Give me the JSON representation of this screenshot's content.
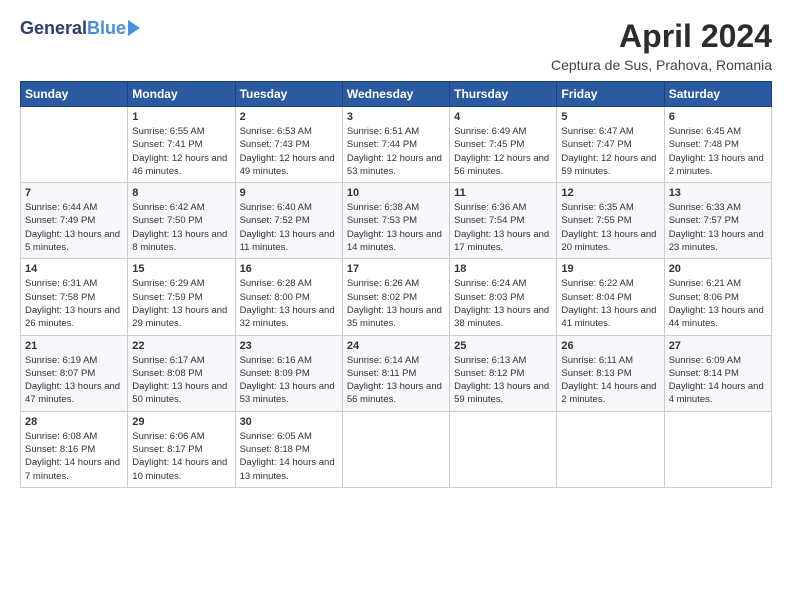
{
  "header": {
    "logo_general": "General",
    "logo_blue": "Blue",
    "title": "April 2024",
    "location": "Ceptura de Sus, Prahova, Romania"
  },
  "days_of_week": [
    "Sunday",
    "Monday",
    "Tuesday",
    "Wednesday",
    "Thursday",
    "Friday",
    "Saturday"
  ],
  "weeks": [
    [
      {
        "day": "",
        "sunrise": "",
        "sunset": "",
        "daylight": ""
      },
      {
        "day": "1",
        "sunrise": "Sunrise: 6:55 AM",
        "sunset": "Sunset: 7:41 PM",
        "daylight": "Daylight: 12 hours and 46 minutes."
      },
      {
        "day": "2",
        "sunrise": "Sunrise: 6:53 AM",
        "sunset": "Sunset: 7:43 PM",
        "daylight": "Daylight: 12 hours and 49 minutes."
      },
      {
        "day": "3",
        "sunrise": "Sunrise: 6:51 AM",
        "sunset": "Sunset: 7:44 PM",
        "daylight": "Daylight: 12 hours and 53 minutes."
      },
      {
        "day": "4",
        "sunrise": "Sunrise: 6:49 AM",
        "sunset": "Sunset: 7:45 PM",
        "daylight": "Daylight: 12 hours and 56 minutes."
      },
      {
        "day": "5",
        "sunrise": "Sunrise: 6:47 AM",
        "sunset": "Sunset: 7:47 PM",
        "daylight": "Daylight: 12 hours and 59 minutes."
      },
      {
        "day": "6",
        "sunrise": "Sunrise: 6:45 AM",
        "sunset": "Sunset: 7:48 PM",
        "daylight": "Daylight: 13 hours and 2 minutes."
      }
    ],
    [
      {
        "day": "7",
        "sunrise": "Sunrise: 6:44 AM",
        "sunset": "Sunset: 7:49 PM",
        "daylight": "Daylight: 13 hours and 5 minutes."
      },
      {
        "day": "8",
        "sunrise": "Sunrise: 6:42 AM",
        "sunset": "Sunset: 7:50 PM",
        "daylight": "Daylight: 13 hours and 8 minutes."
      },
      {
        "day": "9",
        "sunrise": "Sunrise: 6:40 AM",
        "sunset": "Sunset: 7:52 PM",
        "daylight": "Daylight: 13 hours and 11 minutes."
      },
      {
        "day": "10",
        "sunrise": "Sunrise: 6:38 AM",
        "sunset": "Sunset: 7:53 PM",
        "daylight": "Daylight: 13 hours and 14 minutes."
      },
      {
        "day": "11",
        "sunrise": "Sunrise: 6:36 AM",
        "sunset": "Sunset: 7:54 PM",
        "daylight": "Daylight: 13 hours and 17 minutes."
      },
      {
        "day": "12",
        "sunrise": "Sunrise: 6:35 AM",
        "sunset": "Sunset: 7:55 PM",
        "daylight": "Daylight: 13 hours and 20 minutes."
      },
      {
        "day": "13",
        "sunrise": "Sunrise: 6:33 AM",
        "sunset": "Sunset: 7:57 PM",
        "daylight": "Daylight: 13 hours and 23 minutes."
      }
    ],
    [
      {
        "day": "14",
        "sunrise": "Sunrise: 6:31 AM",
        "sunset": "Sunset: 7:58 PM",
        "daylight": "Daylight: 13 hours and 26 minutes."
      },
      {
        "day": "15",
        "sunrise": "Sunrise: 6:29 AM",
        "sunset": "Sunset: 7:59 PM",
        "daylight": "Daylight: 13 hours and 29 minutes."
      },
      {
        "day": "16",
        "sunrise": "Sunrise: 6:28 AM",
        "sunset": "Sunset: 8:00 PM",
        "daylight": "Daylight: 13 hours and 32 minutes."
      },
      {
        "day": "17",
        "sunrise": "Sunrise: 6:26 AM",
        "sunset": "Sunset: 8:02 PM",
        "daylight": "Daylight: 13 hours and 35 minutes."
      },
      {
        "day": "18",
        "sunrise": "Sunrise: 6:24 AM",
        "sunset": "Sunset: 8:03 PM",
        "daylight": "Daylight: 13 hours and 38 minutes."
      },
      {
        "day": "19",
        "sunrise": "Sunrise: 6:22 AM",
        "sunset": "Sunset: 8:04 PM",
        "daylight": "Daylight: 13 hours and 41 minutes."
      },
      {
        "day": "20",
        "sunrise": "Sunrise: 6:21 AM",
        "sunset": "Sunset: 8:06 PM",
        "daylight": "Daylight: 13 hours and 44 minutes."
      }
    ],
    [
      {
        "day": "21",
        "sunrise": "Sunrise: 6:19 AM",
        "sunset": "Sunset: 8:07 PM",
        "daylight": "Daylight: 13 hours and 47 minutes."
      },
      {
        "day": "22",
        "sunrise": "Sunrise: 6:17 AM",
        "sunset": "Sunset: 8:08 PM",
        "daylight": "Daylight: 13 hours and 50 minutes."
      },
      {
        "day": "23",
        "sunrise": "Sunrise: 6:16 AM",
        "sunset": "Sunset: 8:09 PM",
        "daylight": "Daylight: 13 hours and 53 minutes."
      },
      {
        "day": "24",
        "sunrise": "Sunrise: 6:14 AM",
        "sunset": "Sunset: 8:11 PM",
        "daylight": "Daylight: 13 hours and 56 minutes."
      },
      {
        "day": "25",
        "sunrise": "Sunrise: 6:13 AM",
        "sunset": "Sunset: 8:12 PM",
        "daylight": "Daylight: 13 hours and 59 minutes."
      },
      {
        "day": "26",
        "sunrise": "Sunrise: 6:11 AM",
        "sunset": "Sunset: 8:13 PM",
        "daylight": "Daylight: 14 hours and 2 minutes."
      },
      {
        "day": "27",
        "sunrise": "Sunrise: 6:09 AM",
        "sunset": "Sunset: 8:14 PM",
        "daylight": "Daylight: 14 hours and 4 minutes."
      }
    ],
    [
      {
        "day": "28",
        "sunrise": "Sunrise: 6:08 AM",
        "sunset": "Sunset: 8:16 PM",
        "daylight": "Daylight: 14 hours and 7 minutes."
      },
      {
        "day": "29",
        "sunrise": "Sunrise: 6:06 AM",
        "sunset": "Sunset: 8:17 PM",
        "daylight": "Daylight: 14 hours and 10 minutes."
      },
      {
        "day": "30",
        "sunrise": "Sunrise: 6:05 AM",
        "sunset": "Sunset: 8:18 PM",
        "daylight": "Daylight: 14 hours and 13 minutes."
      },
      {
        "day": "",
        "sunrise": "",
        "sunset": "",
        "daylight": ""
      },
      {
        "day": "",
        "sunrise": "",
        "sunset": "",
        "daylight": ""
      },
      {
        "day": "",
        "sunrise": "",
        "sunset": "",
        "daylight": ""
      },
      {
        "day": "",
        "sunrise": "",
        "sunset": "",
        "daylight": ""
      }
    ]
  ]
}
